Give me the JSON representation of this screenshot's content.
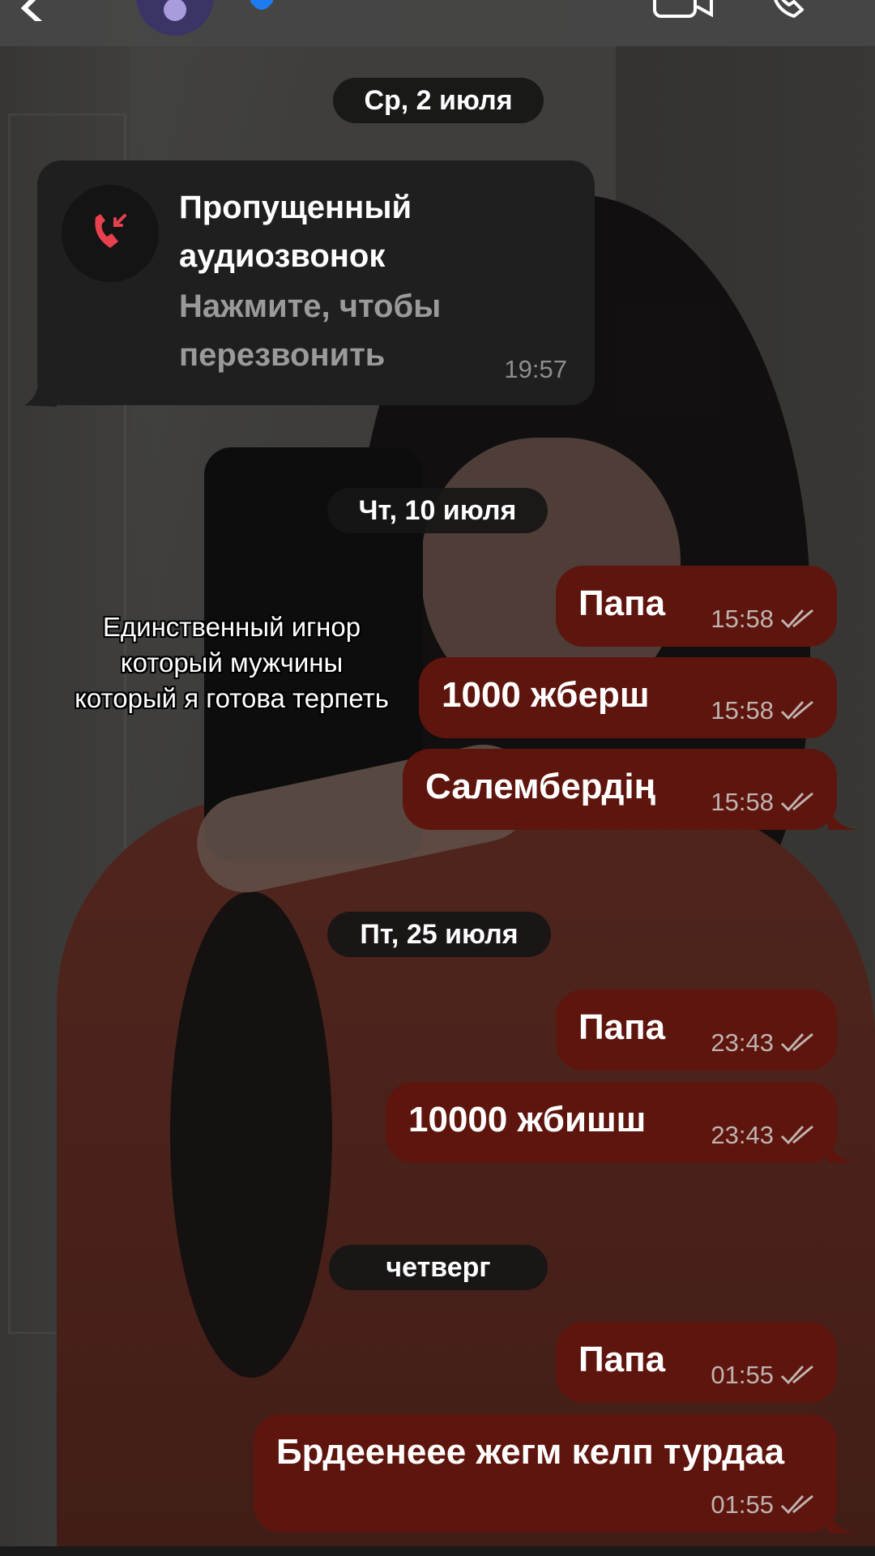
{
  "dates": [
    "Ср, 2 июля",
    "Чт, 10 июля",
    "Пт, 25 июля",
    "четверг"
  ],
  "missed_call": {
    "title": "Пропущенный аудиозвонок",
    "subtitle": "Нажмите, чтобы перезвонить",
    "time": "19:57"
  },
  "caption": "Единственный игнор который мужчины который я готова терпеть",
  "messages": [
    {
      "text": "Папа",
      "time": "15:58"
    },
    {
      "text": "1000 жберш",
      "time": "15:58"
    },
    {
      "text": "Салембердің",
      "time": "15:58"
    },
    {
      "text": "Папа",
      "time": "23:43"
    },
    {
      "text": "10000 жбишш",
      "time": "23:43"
    },
    {
      "text": "Папа",
      "time": "01:55"
    },
    {
      "text": "Брдеенеее жегм келп турдаа",
      "time": "01:55"
    }
  ],
  "icons": {
    "back": "chevron-left-icon",
    "avatar": "user-avatar",
    "verified": "verified-badge-icon",
    "video": "video-call-icon",
    "call": "phone-call-icon",
    "missed": "missed-call-icon",
    "read": "double-check-icon"
  },
  "colors": {
    "outgoing_bubble": "#5e150d",
    "missed_bubble": "#1f1f1f",
    "missed_icon": "#e8404e",
    "date_pill": "#161616"
  }
}
